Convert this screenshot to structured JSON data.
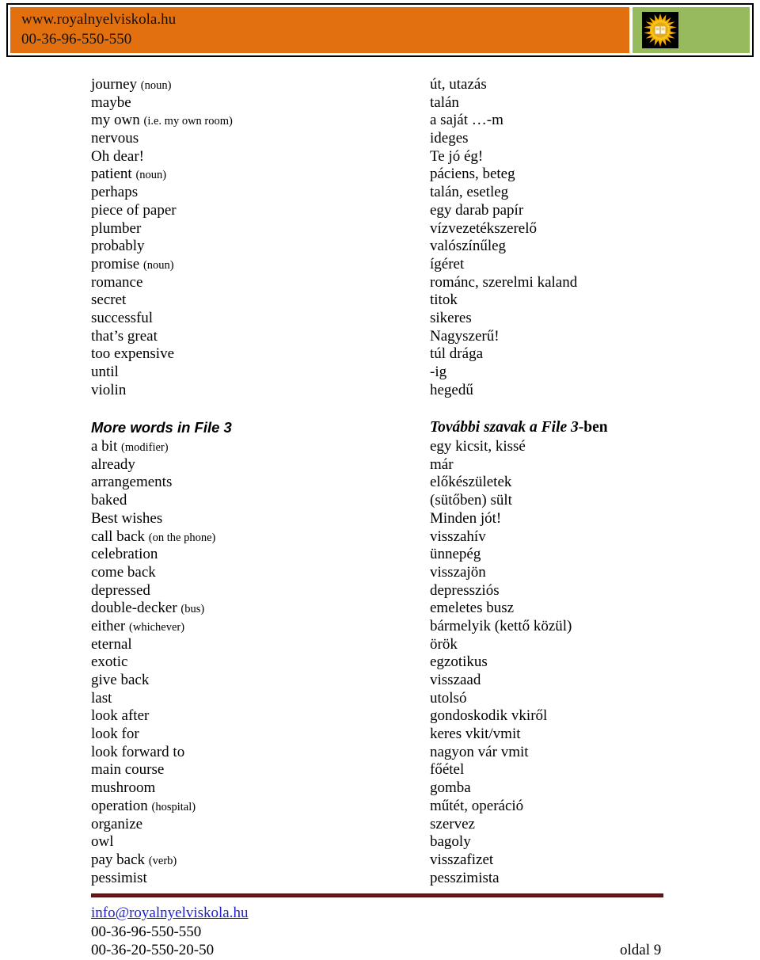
{
  "header": {
    "website": "www.royalnyelviskola.hu",
    "phone": "00-36-96-550-550",
    "logo_icon": "sun-book-logo-icon",
    "orange_color": "#e2700f",
    "green_color": "#97bb5c"
  },
  "sections": [
    {
      "heading_en": null,
      "heading_hu": null,
      "rows": [
        {
          "en": "journey",
          "en_annot": "(noun)",
          "hu": "út, utazás"
        },
        {
          "en": "maybe",
          "en_annot": null,
          "hu": "talán"
        },
        {
          "en": "my own",
          "en_annot": "(i.e. my own room)",
          "hu": "a saját …-m"
        },
        {
          "en": "nervous",
          "en_annot": null,
          "hu": "ideges"
        },
        {
          "en": "Oh dear!",
          "en_annot": null,
          "hu": "Te jó ég!"
        },
        {
          "en": "patient",
          "en_annot": "(noun)",
          "hu": "páciens, beteg"
        },
        {
          "en": "perhaps",
          "en_annot": null,
          "hu": "talán, esetleg"
        },
        {
          "en": "piece of paper",
          "en_annot": null,
          "hu": "egy darab papír"
        },
        {
          "en": "plumber",
          "en_annot": null,
          "hu": "vízvezetékszerelő"
        },
        {
          "en": "probably",
          "en_annot": null,
          "hu": "valószínűleg"
        },
        {
          "en": "promise",
          "en_annot": "(noun)",
          "hu": "ígéret"
        },
        {
          "en": "romance",
          "en_annot": null,
          "hu": "románc, szerelmi kaland"
        },
        {
          "en": "secret",
          "en_annot": null,
          "hu": "titok"
        },
        {
          "en": "successful",
          "en_annot": null,
          "hu": "sikeres"
        },
        {
          "en": "that’s great",
          "en_annot": null,
          "hu": "Nagyszerű!"
        },
        {
          "en": "too expensive",
          "en_annot": null,
          "hu": "túl drága"
        },
        {
          "en": "until",
          "en_annot": null,
          "hu": "-ig"
        },
        {
          "en": "violin",
          "en_annot": null,
          "hu": "hegedű"
        }
      ]
    },
    {
      "heading_en": "More words in File 3",
      "heading_hu_main": "További szavak a File 3",
      "heading_hu_suffix": "-ben",
      "rows": [
        {
          "en": "a bit",
          "en_annot": "(modifier)",
          "hu": "egy kicsit, kissé"
        },
        {
          "en": "already",
          "en_annot": null,
          "hu": "már"
        },
        {
          "en": "arrangements",
          "en_annot": null,
          "hu": "előkészületek"
        },
        {
          "en": "baked",
          "en_annot": null,
          "hu": "(sütőben) sült"
        },
        {
          "en": "Best wishes",
          "en_annot": null,
          "hu": "Minden jót!"
        },
        {
          "en": "call back",
          "en_annot": "(on the phone)",
          "hu": "visszahív"
        },
        {
          "en": "celebration",
          "en_annot": null,
          "hu": "ünnepég"
        },
        {
          "en": "come back",
          "en_annot": null,
          "hu": "visszajön"
        },
        {
          "en": "depressed",
          "en_annot": null,
          "hu": "depressziós"
        },
        {
          "en": "double-decker",
          "en_annot": "(bus)",
          "hu": "emeletes busz"
        },
        {
          "en": "either",
          "en_annot": "(whichever)",
          "hu": "bármelyik (kettő közül)"
        },
        {
          "en": "eternal",
          "en_annot": null,
          "hu": "örök"
        },
        {
          "en": "exotic",
          "en_annot": null,
          "hu": "egzotikus"
        },
        {
          "en": "give back",
          "en_annot": null,
          "hu": "visszaad"
        },
        {
          "en": "last",
          "en_annot": null,
          "hu": "utolsó"
        },
        {
          "en": "look after",
          "en_annot": null,
          "hu": "gondoskodik vkiről"
        },
        {
          "en": "look for",
          "en_annot": null,
          "hu": "keres vkit/vmit"
        },
        {
          "en": "look forward to",
          "en_annot": null,
          "hu": "nagyon vár vmit"
        },
        {
          "en": "main course",
          "en_annot": null,
          "hu": "főétel"
        },
        {
          "en": "mushroom",
          "en_annot": null,
          "hu": "gomba"
        },
        {
          "en": "operation",
          "en_annot": "(hospital)",
          "hu": "műtét, operáció"
        },
        {
          "en": "organize",
          "en_annot": null,
          "hu": "szervez"
        },
        {
          "en": "owl",
          "en_annot": null,
          "hu": "bagoly"
        },
        {
          "en": "pay back",
          "en_annot": "(verb)",
          "hu": "visszafizet"
        },
        {
          "en": "pessimist",
          "en_annot": null,
          "hu": "pesszimista"
        }
      ]
    }
  ],
  "footer": {
    "email": "info@royalnyelviskola.hu",
    "phone1": "00-36-96-550-550",
    "phone2": "00-36-20-550-20-50",
    "page_label": "oldal 9",
    "rule_color": "#6d1313",
    "link_color": "#1f1fd0"
  }
}
